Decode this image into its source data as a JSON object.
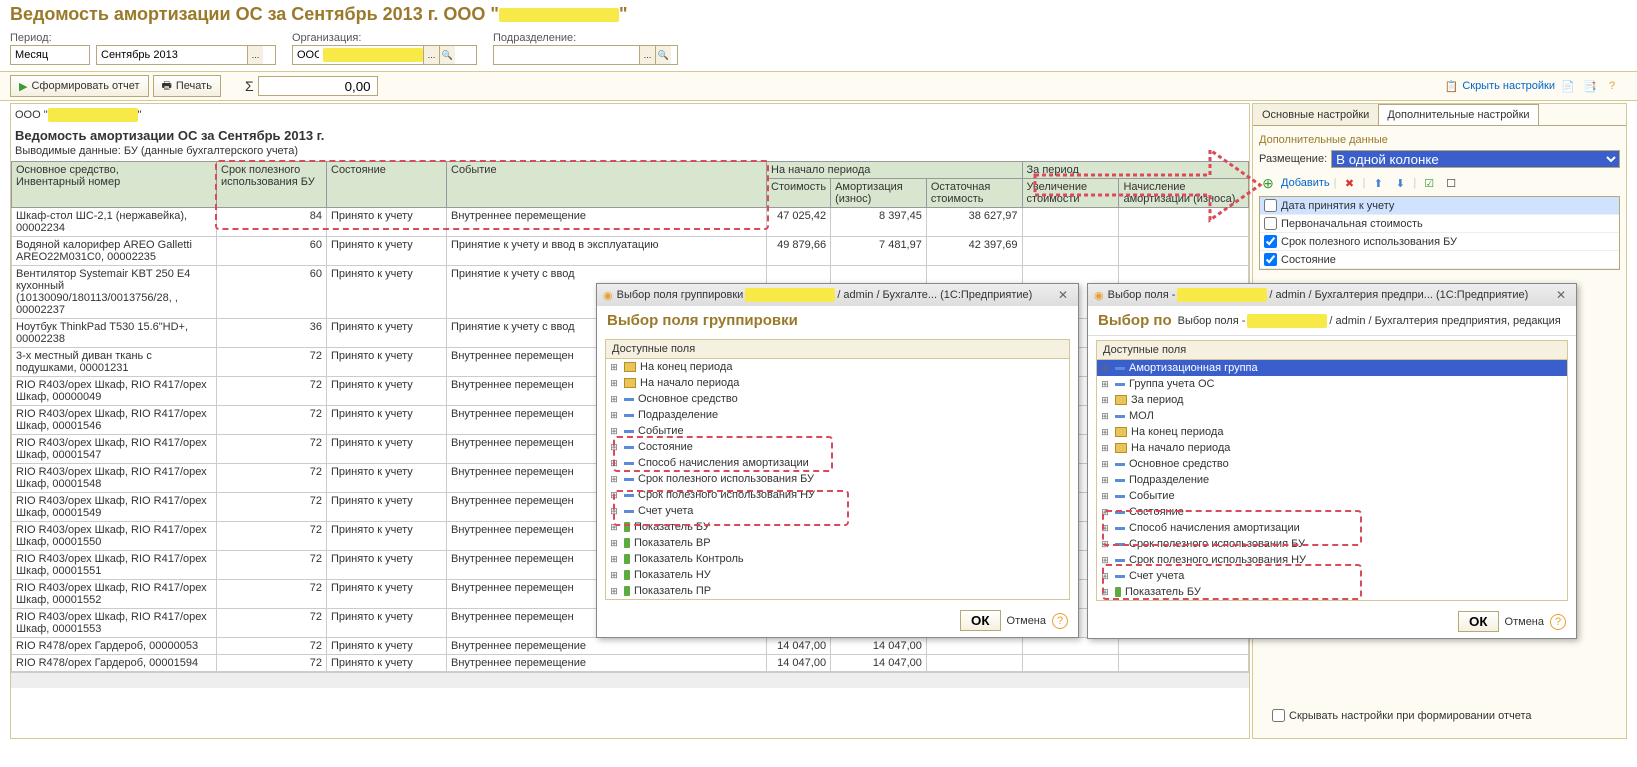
{
  "page_title": "Ведомость амортизации ОС за Сентябрь 2013 г. ООО",
  "filters": {
    "period_label": "Период:",
    "period_type": "Месяц",
    "period_value": "Сентябрь 2013",
    "org_label": "Организация:",
    "org_value": "ООО",
    "dep_label": "Подразделение:",
    "dep_value": ""
  },
  "toolbar": {
    "generate": "Сформировать отчет",
    "print": "Печать",
    "sigma": "Σ",
    "sum_value": "0,00",
    "hide_settings": "Скрыть настройки"
  },
  "report": {
    "org": "ООО \"",
    "title": "Ведомость амортизации ОС за Сентябрь 2013 г.",
    "sub": "Выводимые данные:  БУ (данные бухгалтерского учета)",
    "headers": {
      "asset": "Основное средство,\nИнвентарный номер",
      "life": "Срок полезного использования БУ",
      "state": "Состояние",
      "event": "Событие",
      "start": "На начало периода",
      "cost": "Стоимость",
      "deprec": "Амортизация (износ)",
      "residual": "Остаточная стоимость",
      "period": "За период",
      "inc": "Увеличение стоимости",
      "accr": "Начисление амортизации (износа)"
    },
    "rows": [
      {
        "a": "Шкаф-стол ШС-2,1 (нержавейка), 00002234",
        "l": "84",
        "s": "Принято к учету",
        "e": "Внутреннее перемещение",
        "c": "47 025,42",
        "d": "8 397,45",
        "r": "38 627,97"
      },
      {
        "a": "Водяной калорифер AREO Galletti AREO22M031C0, 00002235",
        "l": "60",
        "s": "Принято к учету",
        "e": "Принятие к учету и ввод в эксплуатацию",
        "c": "49 879,66",
        "d": "7 481,97",
        "r": "42 397,69"
      },
      {
        "a": "Вентилятор Systemair KBT 250 E4 кухонный (10130090/180113/0013756/28, , 00002237",
        "l": "60",
        "s": "Принято к учету",
        "e": "Принятие к учету с ввод",
        "c": "",
        "d": "",
        "r": ""
      },
      {
        "a": "Ноутбук ThinkPad T530 15.6\"HD+, 00002238",
        "l": "36",
        "s": "Принято к учету",
        "e": "Принятие к учету с ввод",
        "c": "",
        "d": "",
        "r": ""
      },
      {
        "a": "3-х местный диван ткань с подушками, 00001231",
        "l": "72",
        "s": "Принято к учету",
        "e": "Внутреннее перемещен",
        "c": "",
        "d": "",
        "r": ""
      },
      {
        "a": "RIO R403/орех Шкаф, RIO R417/орех Шкаф, 00000049",
        "l": "72",
        "s": "Принято к учету",
        "e": "Внутреннее перемещен",
        "c": "",
        "d": "",
        "r": ""
      },
      {
        "a": "RIO R403/орех Шкаф, RIO R417/орех Шкаф, 00001546",
        "l": "72",
        "s": "Принято к учету",
        "e": "Внутреннее перемещен",
        "c": "",
        "d": "",
        "r": ""
      },
      {
        "a": "RIO R403/орех Шкаф, RIO R417/орех Шкаф, 00001547",
        "l": "72",
        "s": "Принято к учету",
        "e": "Внутреннее перемещен",
        "c": "",
        "d": "",
        "r": ""
      },
      {
        "a": "RIO R403/орех Шкаф, RIO R417/орех Шкаф, 00001548",
        "l": "72",
        "s": "Принято к учету",
        "e": "Внутреннее перемещен",
        "c": "",
        "d": "",
        "r": ""
      },
      {
        "a": "RIO R403/орех Шкаф, RIO R417/орех Шкаф, 00001549",
        "l": "72",
        "s": "Принято к учету",
        "e": "Внутреннее перемещен",
        "c": "",
        "d": "",
        "r": ""
      },
      {
        "a": "RIO R403/орех Шкаф, RIO R417/орех Шкаф, 00001550",
        "l": "72",
        "s": "Принято к учету",
        "e": "Внутреннее перемещен",
        "c": "",
        "d": "",
        "r": ""
      },
      {
        "a": "RIO R403/орех Шкаф, RIO R417/орех Шкаф, 00001551",
        "l": "72",
        "s": "Принято к учету",
        "e": "Внутреннее перемещен",
        "c": "",
        "d": "",
        "r": ""
      },
      {
        "a": "RIO R403/орех Шкаф, RIO R417/орех Шкаф, 00001552",
        "l": "72",
        "s": "Принято к учету",
        "e": "Внутреннее перемещен",
        "c": "",
        "d": "",
        "r": ""
      },
      {
        "a": "RIO R403/орех Шкаф, RIO R417/орех Шкаф, 00001553",
        "l": "72",
        "s": "Принято к учету",
        "e": "Внутреннее перемещен",
        "c": "",
        "d": "",
        "r": ""
      },
      {
        "a": "RIO R478/орех Гардероб, 00000053",
        "l": "72",
        "s": "Принято к учету",
        "e": "Внутреннее перемещение",
        "c": "14 047,00",
        "d": "14 047,00",
        "r": ""
      },
      {
        "a": "RIO R478/орех Гардероб, 00001594",
        "l": "72",
        "s": "Принято к учету",
        "e": "Внутреннее перемещение",
        "c": "14 047,00",
        "d": "14 047,00",
        "r": ""
      }
    ]
  },
  "settings": {
    "tab1": "Основные настройки",
    "tab2": "Дополнительные настройки",
    "addl": "Дополнительные данные",
    "placement": "Размещение:",
    "placement_value": "В одной колонке",
    "add": "Добавить",
    "checks": [
      {
        "c": false,
        "t": "Дата принятия к учету",
        "sel": true
      },
      {
        "c": false,
        "t": "Первоначальная стоимость"
      },
      {
        "c": true,
        "t": "Срок полезного использования БУ"
      },
      {
        "c": true,
        "t": "Состояние"
      }
    ],
    "hide_on_gen": "Скрывать настройки при формировании отчета"
  },
  "dialog1": {
    "titlebar": "Выбор поля группировки",
    "breadcrumb": " / admin / Бухгалте...   (1С:Предприятие)",
    "title": "Выбор поля группировки",
    "fields_label": "Доступные поля",
    "items": [
      {
        "t": "На конец периода",
        "i": "f"
      },
      {
        "t": "На начало периода",
        "i": "f"
      },
      {
        "t": "Основное средство",
        "i": "d"
      },
      {
        "t": "Подразделение",
        "i": "d"
      },
      {
        "t": "Событие",
        "i": "d"
      },
      {
        "t": "Состояние",
        "i": "d"
      },
      {
        "t": "Способ начисления амортизации",
        "i": "d"
      },
      {
        "t": "Срок полезного использования БУ",
        "i": "d"
      },
      {
        "t": "Срок полезного использования НУ",
        "i": "d"
      },
      {
        "t": "Счет учета",
        "i": "d"
      },
      {
        "t": "Показатель БУ",
        "i": "g"
      },
      {
        "t": "Показатель ВР",
        "i": "g"
      },
      {
        "t": "Показатель Контроль",
        "i": "g"
      },
      {
        "t": "Показатель НУ",
        "i": "g"
      },
      {
        "t": "Показатель ПР",
        "i": "g"
      }
    ],
    "ok": "ОК",
    "cancel": "Отмена"
  },
  "dialog2": {
    "titlebar": "Выбор поля -",
    "breadcrumb": " / admin / Бухгалтерия предпри...   (1С:Предприятие)",
    "subbar": "Выбор поля -",
    "subbread": " / admin / Бухгалтерия предприятия, редакция",
    "title": "Выбор по",
    "fields_label": "Доступные поля",
    "items": [
      {
        "t": "Амортизационная группа",
        "i": "d",
        "sel": true
      },
      {
        "t": "Группа учета ОС",
        "i": "d"
      },
      {
        "t": "За период",
        "i": "f"
      },
      {
        "t": "МОЛ",
        "i": "d"
      },
      {
        "t": "На конец периода",
        "i": "f"
      },
      {
        "t": "На начало периода",
        "i": "f"
      },
      {
        "t": "Основное средство",
        "i": "d"
      },
      {
        "t": "Подразделение",
        "i": "d"
      },
      {
        "t": "Событие",
        "i": "d"
      },
      {
        "t": "Состояние",
        "i": "d"
      },
      {
        "t": "Способ начисления амортизации",
        "i": "d"
      },
      {
        "t": "Срок полезного использования БУ",
        "i": "d"
      },
      {
        "t": "Срок полезного использования НУ",
        "i": "d"
      },
      {
        "t": "Счет учета",
        "i": "d"
      },
      {
        "t": "Показатель БУ",
        "i": "g"
      }
    ],
    "ok": "ОК",
    "cancel": "Отмена"
  }
}
